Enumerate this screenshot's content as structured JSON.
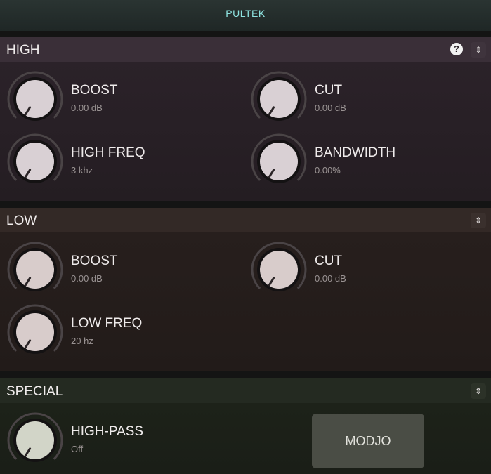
{
  "app": {
    "title": "PULTEK"
  },
  "sections": {
    "high": {
      "title": "HIGH",
      "controls": {
        "boost": {
          "label": "BOOST",
          "value": "0.00 dB"
        },
        "cut": {
          "label": "CUT",
          "value": "0.00 dB"
        },
        "freq": {
          "label": "HIGH FREQ",
          "value": "3 khz"
        },
        "bandwidth": {
          "label": "BANDWIDTH",
          "value": "0.00%"
        }
      }
    },
    "low": {
      "title": "LOW",
      "controls": {
        "boost": {
          "label": "BOOST",
          "value": "0.00 dB"
        },
        "cut": {
          "label": "CUT",
          "value": "0.00 dB"
        },
        "freq": {
          "label": "LOW FREQ",
          "value": "20 hz"
        }
      }
    },
    "special": {
      "title": "SPECIAL",
      "controls": {
        "highpass": {
          "label": "HIGH-PASS",
          "value": "Off"
        }
      },
      "modjo_label": "MODJO"
    }
  },
  "icons": {
    "help": "help-icon",
    "toggle": "up-down-chevron-icon"
  },
  "colors": {
    "accent": "#8ee3e0",
    "knob_high": "#d9d0d4",
    "knob_low": "#d8cccb",
    "knob_special": "#d2d5c8"
  }
}
